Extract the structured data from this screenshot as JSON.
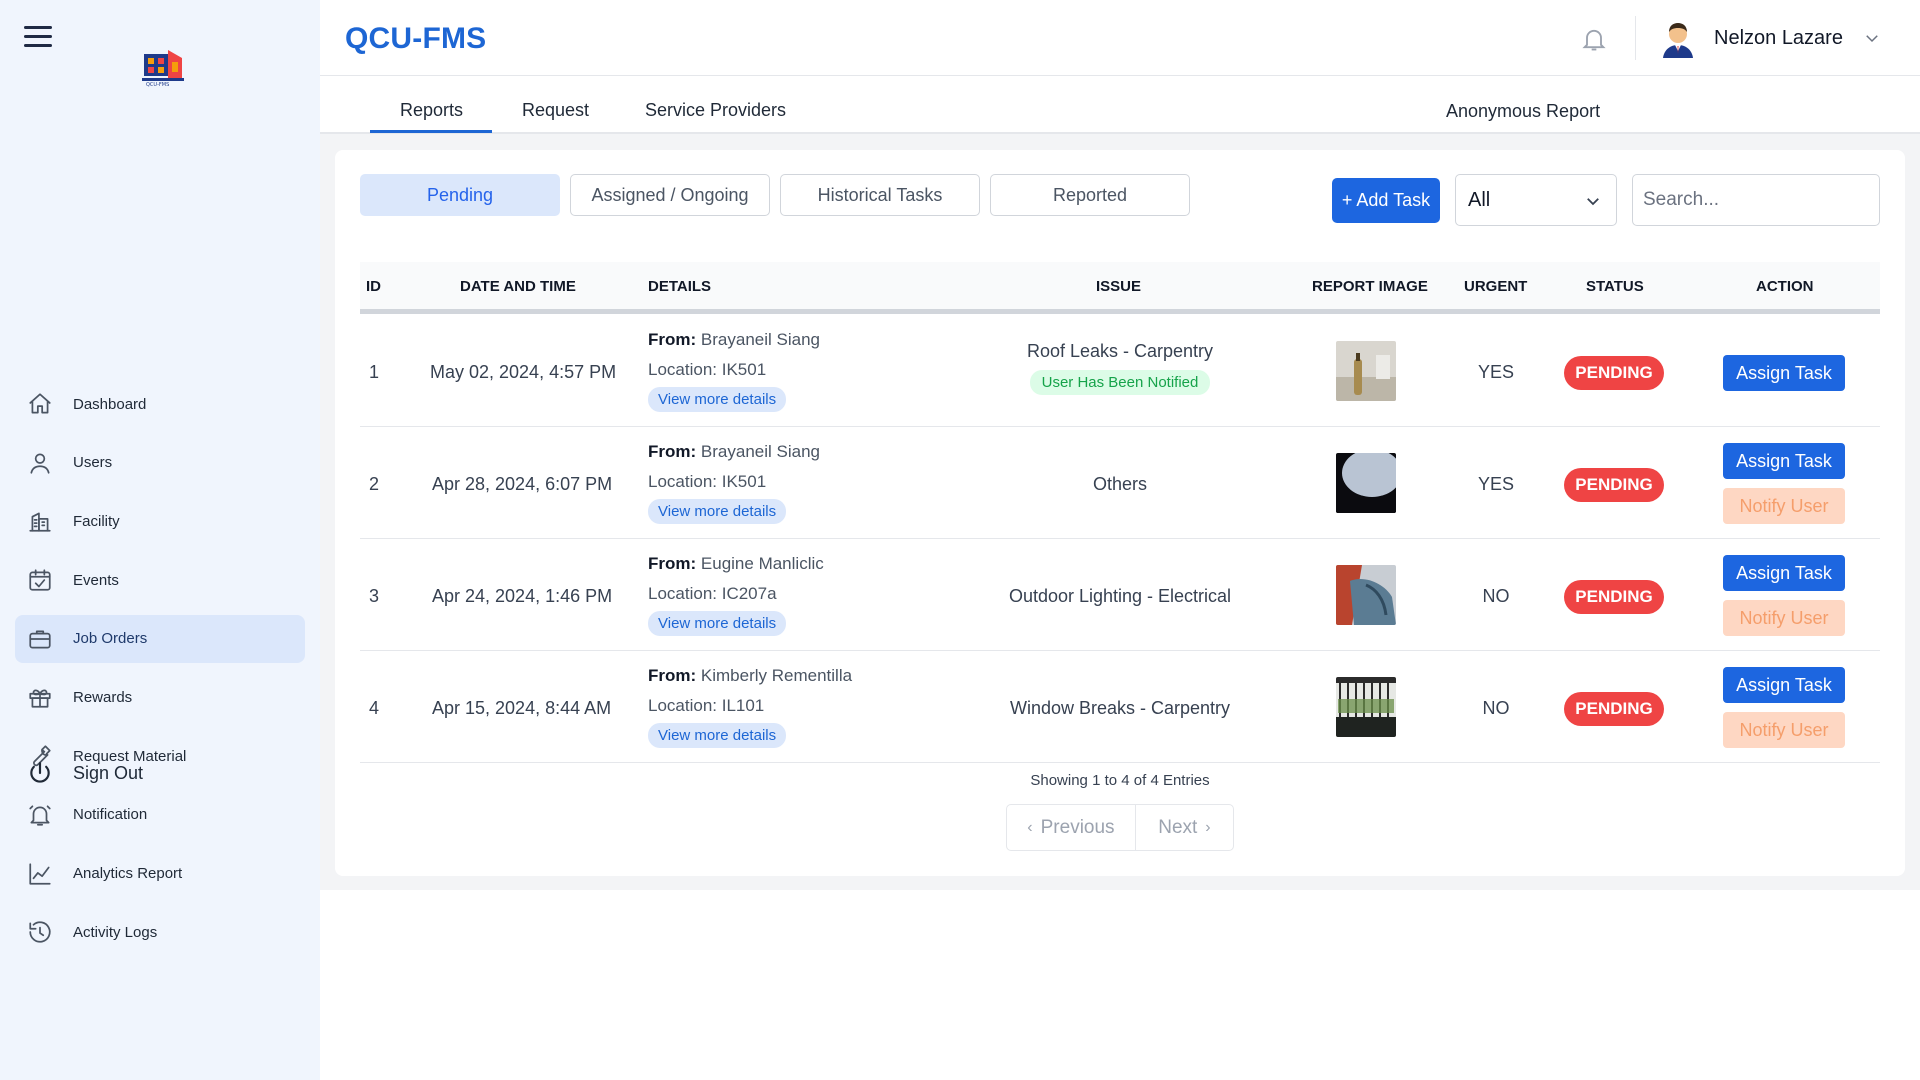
{
  "app": {
    "title": "QCU-FMS"
  },
  "sidebar": {
    "items": [
      {
        "label": "Dashboard",
        "icon": "home-icon"
      },
      {
        "label": "Users",
        "icon": "user-icon"
      },
      {
        "label": "Facility",
        "icon": "building-icon"
      },
      {
        "label": "Events",
        "icon": "calendar-check-icon"
      },
      {
        "label": "Job Orders",
        "icon": "briefcase-icon",
        "active": true
      },
      {
        "label": "Rewards",
        "icon": "gift-icon"
      },
      {
        "label": "Request Material",
        "icon": "wrench-icon"
      },
      {
        "label": "Notification",
        "icon": "bell-icon"
      },
      {
        "label": "Analytics Report",
        "icon": "chart-line-icon"
      },
      {
        "label": "Activity Logs",
        "icon": "history-icon"
      }
    ],
    "signout": "Sign Out"
  },
  "header": {
    "user_name": "Nelzon Lazare"
  },
  "tabs": [
    "Reports",
    "Request",
    "Service Providers",
    "Anonymous Report"
  ],
  "filters": [
    "Pending",
    "Assigned / Ongoing",
    "Historical Tasks",
    "Reported"
  ],
  "toolbar": {
    "add_task": "+ Add Task",
    "select_value": "All",
    "search_placeholder": "Search..."
  },
  "table": {
    "headers": [
      "ID",
      "DATE AND TIME",
      "DETAILS",
      "ISSUE",
      "REPORT IMAGE",
      "URGENT",
      "STATUS",
      "ACTION"
    ],
    "rows": [
      {
        "id": "1",
        "datetime": "May 02, 2024, 4:57 PM",
        "from_label": "From:",
        "from": "Brayaneil Siang",
        "location": "Location: IK501",
        "view_more": "View more details",
        "issue": "Roof Leaks - Carpentry",
        "notified": "User Has Been Notified",
        "urgent": "YES",
        "status": "PENDING",
        "assign": "Assign Task"
      },
      {
        "id": "2",
        "datetime": "Apr 28, 2024, 6:07 PM",
        "from_label": "From:",
        "from": "Brayaneil Siang",
        "location": "Location: IK501",
        "view_more": "View more details",
        "issue": "Others",
        "urgent": "YES",
        "status": "PENDING",
        "assign": "Assign Task",
        "notify": "Notify User"
      },
      {
        "id": "3",
        "datetime": "Apr 24, 2024, 1:46 PM",
        "from_label": "From:",
        "from": "Eugine Manliclic",
        "location": "Location: IC207a",
        "view_more": "View more details",
        "issue": "Outdoor Lighting - Electrical",
        "urgent": "NO",
        "status": "PENDING",
        "assign": "Assign Task",
        "notify": "Notify User"
      },
      {
        "id": "4",
        "datetime": "Apr 15, 2024, 8:44 AM",
        "from_label": "From:",
        "from": "Kimberly Rementilla",
        "location": "Location: IL101",
        "view_more": "View more details",
        "issue": "Window Breaks - Carpentry",
        "urgent": "NO",
        "status": "PENDING",
        "assign": "Assign Task",
        "notify": "Notify User"
      }
    ]
  },
  "pagination": {
    "showing": "Showing 1 to 4 of 4 Entries",
    "previous": "Previous",
    "next": "Next"
  },
  "colors": {
    "primary": "#1d66e0",
    "danger": "#ef4444",
    "sidebar_bg": "#f0f5fd",
    "notify_bg": "#fed7c3"
  }
}
